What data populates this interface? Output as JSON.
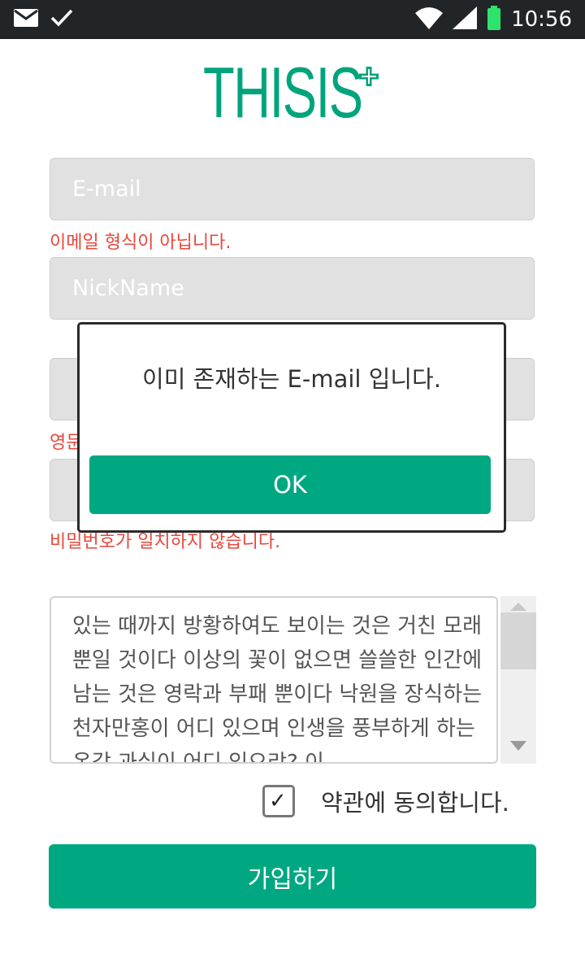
{
  "status_bar": {
    "time": "10:56",
    "icons": [
      "mail-icon",
      "check-icon",
      "wifi-icon",
      "signal-icon",
      "battery-icon"
    ]
  },
  "logo": {
    "text": "THISIS",
    "color": "#00a47c"
  },
  "form": {
    "email": {
      "placeholder": "E-mail",
      "value": "",
      "error": "이메일 형식이 아닙니다."
    },
    "nickname": {
      "placeholder": "NickName",
      "value": ""
    },
    "password": {
      "placeholder": "",
      "value": "",
      "error": "영문"
    },
    "password_confirm": {
      "placeholder": "",
      "value": "",
      "error": "비밀번호가 일치하지 않습니다."
    },
    "terms_text": "있는 때까지 방황하여도 보이는 것은 거친 모래뿐일 것이다 이상의 꽃이 없으면 쓸쓸한 인간에 남는 것은 영락과 부패 뿐이다 낙원을 장식하는 천자만홍이 어디 있으며 인생을 풍부하게 하는 온갖 과실이 어디 있으랴? 이",
    "agree_label": "약관에 동의합니다.",
    "agree_checked": true,
    "submit_label": "가입하기"
  },
  "dialog": {
    "message": "이미 존재하는 E-mail 입니다.",
    "ok_label": "OK"
  },
  "colors": {
    "accent": "#00a882",
    "error": "#e8473b",
    "statusbar": "#212528"
  }
}
